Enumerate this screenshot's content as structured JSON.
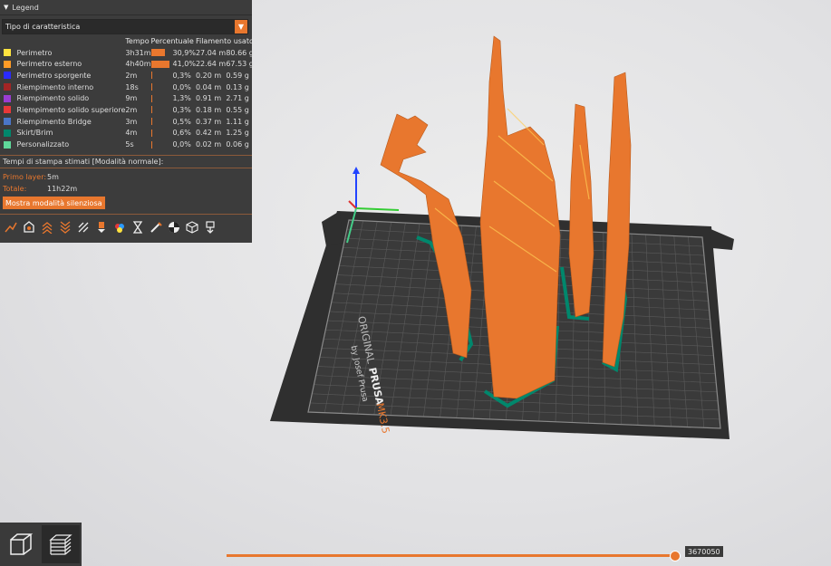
{
  "legend": {
    "title": "Legend",
    "combo_value": "Tipo di caratteristica",
    "headers": {
      "time": "Tempo",
      "percent": "Percentuale",
      "filament": "Filamento usato"
    },
    "features": [
      {
        "color": "#ffe33f",
        "name": "Perimetro",
        "time": "3h31m",
        "percent": "30,9%",
        "bar": 0.309,
        "length": "27.04 m",
        "weight": "80.66 g"
      },
      {
        "color": "#ff9b26",
        "name": "Perimetro esterno",
        "time": "4h40m",
        "percent": "41,0%",
        "bar": 0.41,
        "length": "22.64 m",
        "weight": "67.53 g"
      },
      {
        "color": "#2a2aff",
        "name": "Perimetro sporgente",
        "time": "2m",
        "percent": "0,3%",
        "bar": 0.003,
        "length": "0.20 m",
        "weight": "0.59 g"
      },
      {
        "color": "#a32525",
        "name": "Riempimento interno",
        "time": "18s",
        "percent": "0,0%",
        "bar": 0.0,
        "length": "0.04 m",
        "weight": "0.13 g"
      },
      {
        "color": "#9a3dd1",
        "name": "Riempimento solido",
        "time": "9m",
        "percent": "1,3%",
        "bar": 0.013,
        "length": "0.91 m",
        "weight": "2.71 g"
      },
      {
        "color": "#e83838",
        "name": "Riempimento solido superiore",
        "time": "2m",
        "percent": "0,3%",
        "bar": 0.003,
        "length": "0.18 m",
        "weight": "0.55 g"
      },
      {
        "color": "#4a76c8",
        "name": "Riempimento Bridge",
        "time": "3m",
        "percent": "0,5%",
        "bar": 0.005,
        "length": "0.37 m",
        "weight": "1.11 g"
      },
      {
        "color": "#00876c",
        "name": "Skirt/Brim",
        "time": "4m",
        "percent": "0,6%",
        "bar": 0.006,
        "length": "0.42 m",
        "weight": "1.25 g"
      },
      {
        "color": "#5fd89a",
        "name": "Personalizzato",
        "time": "5s",
        "percent": "0,0%",
        "bar": 0.0,
        "length": "0.02 m",
        "weight": "0.06 g"
      }
    ],
    "estimated_title": "Tempi di stampa stimati [Modalità normale]:",
    "first_layer_label": "Primo layer:",
    "first_layer_value": "5m",
    "total_label": "Totale:",
    "total_value": "11h22m",
    "silent_button": "Mostra modalità silenziosa",
    "toolbar_icons": [
      "travel-icon",
      "wipe-icon",
      "retractions-icon",
      "deretractions-icon",
      "seams-icon",
      "tool-changes-icon",
      "color-changes-icon",
      "pause-icon",
      "custom-gcode-icon",
      "center-of-gravity-icon",
      "shells-icon",
      "tool-marker-icon"
    ]
  },
  "bed": {
    "brand": "ORIGINAL",
    "brand2": "PRUSA",
    "model": "MK3.5",
    "by": "by Josef Prusa"
  },
  "bottom": {
    "slider_value": "3670050",
    "slider_fraction": 1.0
  },
  "colors": {
    "accent": "#e8772e",
    "model": "#e8772e",
    "brim": "#00876c"
  }
}
